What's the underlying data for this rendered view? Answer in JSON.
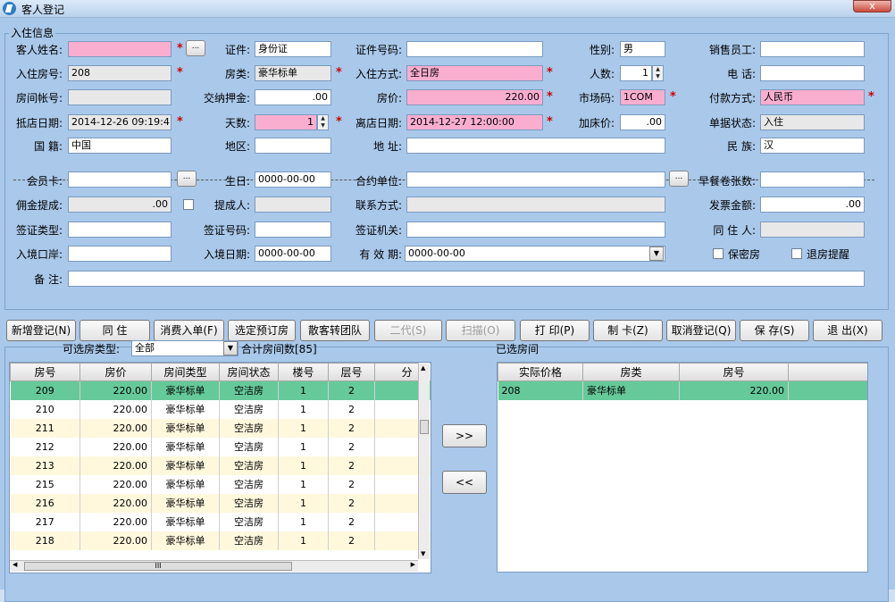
{
  "window": {
    "title": "客人登记",
    "close": "x"
  },
  "group": {
    "legend": "入住信息"
  },
  "f": {
    "guest_name": {
      "label": "客人姓名:",
      "value": ""
    },
    "id_type": {
      "label": "证件:",
      "value": "身份证"
    },
    "id_no": {
      "label": "证件号码:",
      "value": ""
    },
    "gender": {
      "label": "性别:",
      "value": "男"
    },
    "sales": {
      "label": "销售员工:",
      "value": ""
    },
    "room_no": {
      "label": "入住房号:",
      "value": "208"
    },
    "room_type": {
      "label": "房类:",
      "value": "豪华标单"
    },
    "checkin_mode": {
      "label": "入住方式:",
      "value": "全日房"
    },
    "persons": {
      "label": "人数:",
      "value": "1"
    },
    "phone": {
      "label": "电    话:",
      "value": ""
    },
    "account": {
      "label": "房间帐号:",
      "value": ""
    },
    "deposit": {
      "label": "交纳押金:",
      "value": ".00"
    },
    "price": {
      "label": "房价:",
      "value": "220.00"
    },
    "market": {
      "label": "市场码:",
      "value": "1COM"
    },
    "payment": {
      "label": "付款方式:",
      "value": "人民币"
    },
    "arrive": {
      "label": "抵店日期:",
      "value": "2014-12-26 09:19:41"
    },
    "days": {
      "label": "天数:",
      "value": "1"
    },
    "depart": {
      "label": "离店日期:",
      "value": "2014-12-27 12:00:00"
    },
    "extra_bed": {
      "label": "加床价:",
      "value": ".00"
    },
    "doc_status": {
      "label": "单据状态:",
      "value": "入住"
    },
    "nationality": {
      "label": "国  籍:",
      "value": "中国"
    },
    "region": {
      "label": "地区:",
      "value": ""
    },
    "address": {
      "label": "地    址:",
      "value": ""
    },
    "ethnic": {
      "label": "民    族:",
      "value": "汉"
    },
    "member_card": {
      "label": "会员卡:",
      "value": ""
    },
    "birthday": {
      "label": "生日:",
      "value": "0000-00-00"
    },
    "contract": {
      "label": "合约单位:",
      "value": ""
    },
    "breakfast": {
      "label": "早餐卷张数:",
      "value": ""
    },
    "commission": {
      "label": "佣金提成:",
      "value": ".00"
    },
    "commissioner": {
      "label": "提成人:",
      "value": ""
    },
    "contact": {
      "label": "联系方式:",
      "value": ""
    },
    "invoice": {
      "label": "发票金额:",
      "value": ".00"
    },
    "visa_type": {
      "label": "签证类型:",
      "value": ""
    },
    "visa_no": {
      "label": "签证号码:",
      "value": ""
    },
    "visa_org": {
      "label": "签证机关:",
      "value": ""
    },
    "cohabitant": {
      "label": "同 住 人:",
      "value": ""
    },
    "port": {
      "label": "入境口岸:",
      "value": ""
    },
    "entry_date": {
      "label": "入境日期:",
      "value": "0000-00-00"
    },
    "valid": {
      "label": "有 效 期:",
      "value": "0000-00-00"
    },
    "remark": {
      "label": "备  注:",
      "value": ""
    }
  },
  "checks": {
    "secret": "保密房",
    "remind": "退房提醒"
  },
  "dots": "...",
  "req": "*",
  "buttons": [
    "新增登记(N)",
    "同    住",
    "消费入单(F)",
    "选定预订房",
    "散客转团队",
    "二代(S)",
    "扫描(O)",
    "打    印(P)",
    "制    卡(Z)",
    "取消登记(Q)",
    "保    存(S)",
    "退    出(X)"
  ],
  "bottom": {
    "type_label": "可选房类型:",
    "type_value": "全部",
    "count_label": "合计房间数[85]",
    "selected_label": "已选房间",
    "move_right": ">>",
    "move_left": "<<",
    "left_columns": [
      "房号",
      "房价",
      "房间类型",
      "房间状态",
      "楼号",
      "层号",
      "分"
    ],
    "left_rows": [
      [
        "209",
        "220.00",
        "豪华标单",
        "空洁房",
        "1",
        "2"
      ],
      [
        "210",
        "220.00",
        "豪华标单",
        "空洁房",
        "1",
        "2"
      ],
      [
        "211",
        "220.00",
        "豪华标单",
        "空洁房",
        "1",
        "2"
      ],
      [
        "212",
        "220.00",
        "豪华标单",
        "空洁房",
        "1",
        "2"
      ],
      [
        "213",
        "220.00",
        "豪华标单",
        "空洁房",
        "1",
        "2"
      ],
      [
        "215",
        "220.00",
        "豪华标单",
        "空洁房",
        "1",
        "2"
      ],
      [
        "216",
        "220.00",
        "豪华标单",
        "空洁房",
        "1",
        "2"
      ],
      [
        "217",
        "220.00",
        "豪华标单",
        "空洁房",
        "1",
        "2"
      ],
      [
        "218",
        "220.00",
        "豪华标单",
        "空洁房",
        "1",
        "2"
      ]
    ],
    "right_columns": [
      "房号",
      "房类",
      "实际价格"
    ],
    "right_rows": [
      [
        "208",
        "豪华标单",
        "220.00"
      ]
    ],
    "hscroll_grip": "III"
  }
}
